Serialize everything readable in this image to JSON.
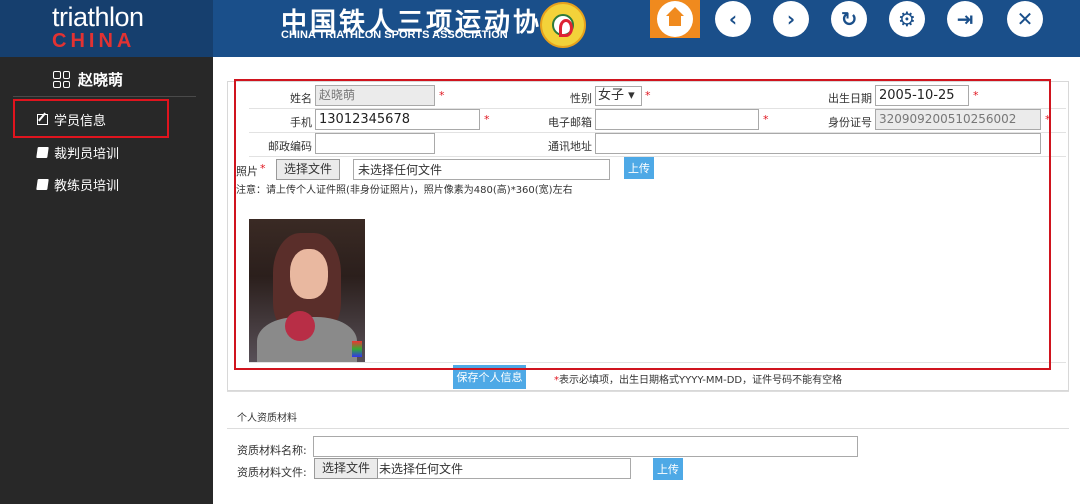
{
  "header": {
    "logo_top": "triathlon",
    "logo_bottom": "CHINA",
    "assoc_cn": "中国铁人三项运动协会",
    "assoc_en": "CHINA TRIATHLON SPORTS ASSOCIATION",
    "nav": {
      "back": "‹",
      "forward": "›",
      "refresh": "↻",
      "settings": "⚙",
      "logout": "⇥",
      "close": "✕"
    }
  },
  "sidebar": {
    "username": "赵晓萌",
    "items": [
      {
        "label": "学员信息"
      },
      {
        "label": "裁判员培训"
      },
      {
        "label": "教练员培训"
      }
    ]
  },
  "form": {
    "name": {
      "label": "姓名",
      "value": "赵晓萌",
      "required": "*"
    },
    "gender": {
      "label": "性别",
      "value": "女子 ▾",
      "required": "*"
    },
    "birth": {
      "label": "出生日期",
      "value": "2005-10-25",
      "required": "*"
    },
    "mobile": {
      "label": "手机",
      "value": "13012345678",
      "required": "*"
    },
    "email": {
      "label": "电子邮箱",
      "value": "",
      "required": "*"
    },
    "idcard": {
      "label": "身份证号",
      "value": "320909200510256002",
      "required": "*"
    },
    "postcode": {
      "label": "邮政编码",
      "value": ""
    },
    "address": {
      "label": "通讯地址",
      "value": ""
    },
    "photo": {
      "label": "照片",
      "required": "*",
      "choose_file": "选择文件",
      "no_file": "未选择任何文件",
      "upload": "上传",
      "note": "注意：请上传个人证件照(非身份证照片)，照片像素为480(高)*360(宽)左右"
    },
    "save": "保存个人信息",
    "save_note_star": "*",
    "save_note": "表示必填项，出生日期格式YYYY-MM-DD，证件号码不能有空格"
  },
  "qualification": {
    "title": "个人资质材料",
    "name_label": "资质材料名称:",
    "name_value": "",
    "file_label": "资质材料文件:",
    "choose_file": "选择文件",
    "no_file": "未选择任何文件",
    "upload": "上传"
  },
  "colors": {
    "header_bg": "#1a4f8a",
    "sidebar_bg": "#282828",
    "accent_red": "#e0141e",
    "button_blue": "#4ea9e6",
    "home_orange": "#f08a1e"
  }
}
